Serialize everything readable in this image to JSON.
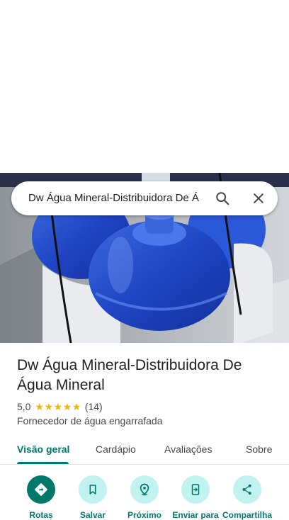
{
  "search": {
    "query": "Dw Água Mineral-Distribuidora De Á"
  },
  "place": {
    "name": "Dw Água Mineral-Distribuidora De Água Mineral",
    "rating": "5,0",
    "stars": 5,
    "review_count": "(14)",
    "category": "Fornecedor de água engarrafada"
  },
  "tabs": [
    {
      "label": "Visão geral",
      "active": true
    },
    {
      "label": "Cardápio",
      "active": false
    },
    {
      "label": "Avaliações",
      "active": false
    },
    {
      "label": "Sobre",
      "active": false
    }
  ],
  "actions": [
    {
      "label": "Rotas",
      "icon": "directions-icon"
    },
    {
      "label": "Salvar",
      "icon": "bookmark-icon"
    },
    {
      "label": "Próximo",
      "icon": "nearby-icon"
    },
    {
      "label": "Enviar para",
      "icon": "send-to-phone-icon"
    },
    {
      "label": "Compartilha",
      "icon": "share-icon"
    }
  ],
  "colors": {
    "accent": "#00796b",
    "accent_light": "#c2f2ef",
    "star": "#f4b400"
  }
}
